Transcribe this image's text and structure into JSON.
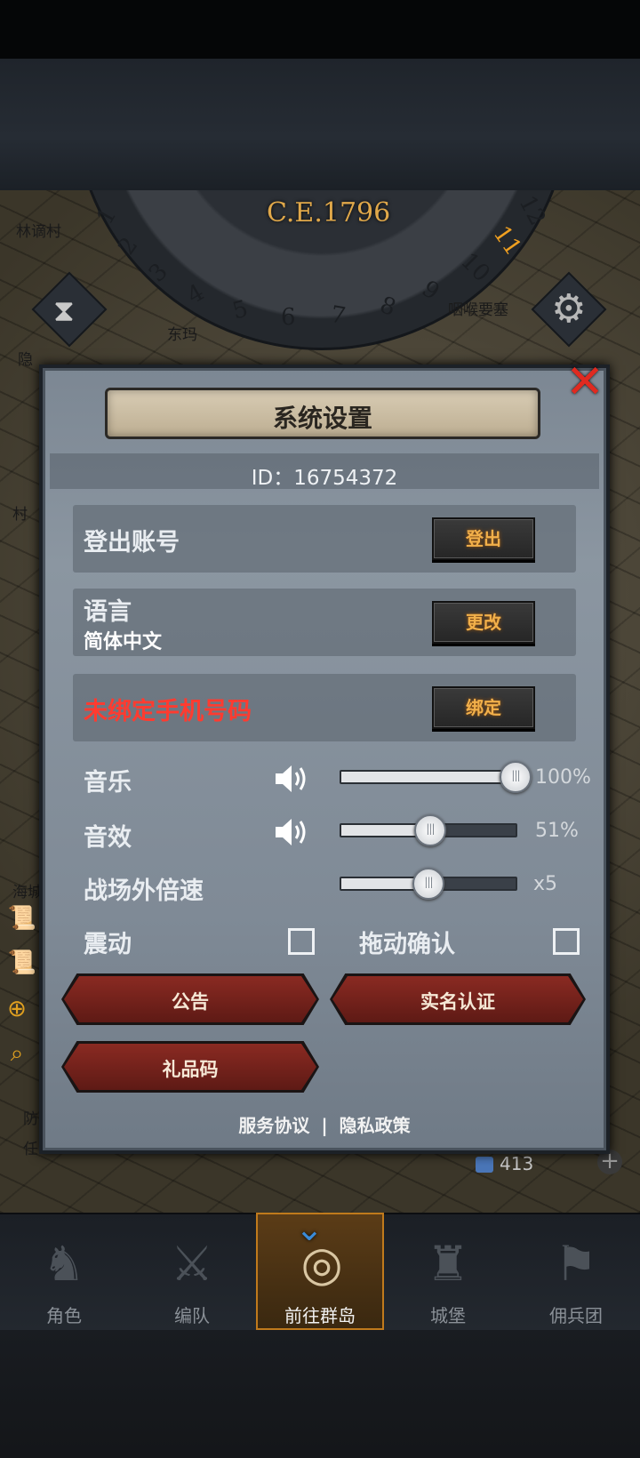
{
  "hud": {
    "year": "C.E.1796",
    "dial_numbers": [
      "1",
      "2",
      "3",
      "4",
      "5",
      "6",
      "7",
      "8",
      "9",
      "10",
      "11",
      "12"
    ],
    "current_month": "11",
    "map_labels": [
      "林谪村",
      "咽喉要塞",
      "东玛",
      "隐",
      "村",
      "海城",
      "防",
      "任"
    ],
    "resource_value": "413"
  },
  "dialog": {
    "title": "系统设置",
    "id_text": "ID：16754372",
    "account": {
      "label": "登出账号",
      "button": "登出"
    },
    "language": {
      "label": "语言",
      "value": "简体中文",
      "button": "更改"
    },
    "phone": {
      "label": "未绑定手机号码",
      "button": "绑定",
      "label_color": "#ff3b30"
    },
    "music": {
      "label": "音乐",
      "value": 100,
      "value_text": "100%"
    },
    "sfx": {
      "label": "音效",
      "value": 51,
      "value_text": "51%"
    },
    "speed": {
      "label": "战场外倍速",
      "value": 50,
      "value_text": "x5"
    },
    "vibration": {
      "label": "震动",
      "checked": false
    },
    "drag_confirm": {
      "label": "拖动确认",
      "checked": false
    },
    "buttons": {
      "notice": "公告",
      "real_name": "实名认证",
      "gift_code": "礼品码"
    },
    "footer": {
      "service": "服务协议",
      "separator": "|",
      "privacy": "隐私政策"
    }
  },
  "bottom_nav": {
    "items": [
      {
        "label": "角色",
        "icon": "knight-helmet-icon"
      },
      {
        "label": "编队",
        "icon": "formation-icon"
      },
      {
        "label": "前往群岛",
        "icon": "world-map-icon",
        "active": true
      },
      {
        "label": "城堡",
        "icon": "castle-icon"
      },
      {
        "label": "佣兵团",
        "icon": "mercenary-banner-icon"
      }
    ]
  },
  "colors": {
    "accent_gold": "#f2b04a",
    "warning_red": "#ff3b30",
    "close_red": "#e02a20",
    "active_nav": "#c07a1c"
  }
}
